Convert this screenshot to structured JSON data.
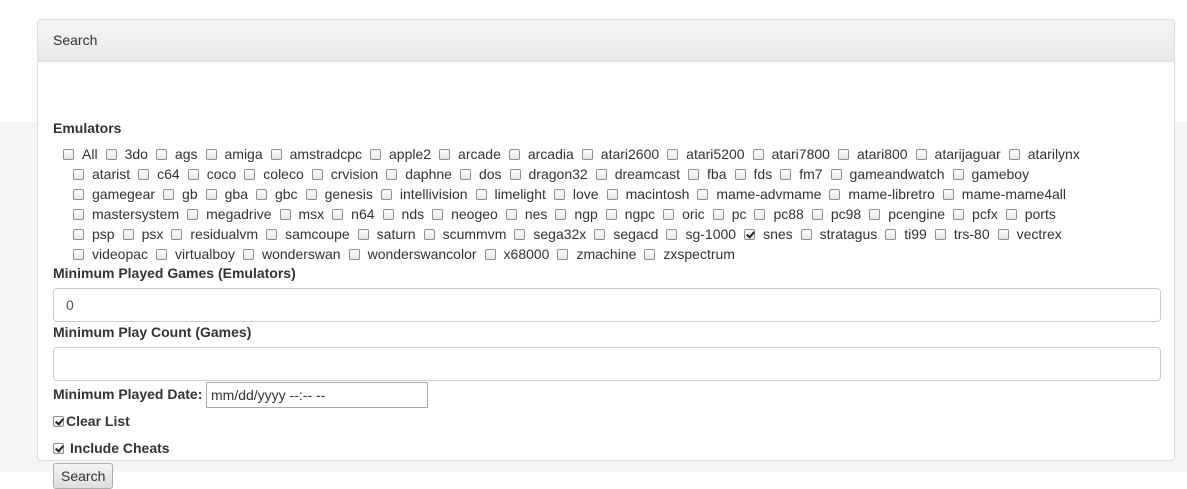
{
  "panel": {
    "title": "Search"
  },
  "emulators": {
    "label": "Emulators",
    "rows": [
      [
        {
          "name": "All",
          "checked": false
        },
        {
          "name": "3do",
          "checked": false
        },
        {
          "name": "ags",
          "checked": false
        },
        {
          "name": "amiga",
          "checked": false
        },
        {
          "name": "amstradcpc",
          "checked": false
        },
        {
          "name": "apple2",
          "checked": false
        },
        {
          "name": "arcade",
          "checked": false
        },
        {
          "name": "arcadia",
          "checked": false
        },
        {
          "name": "atari2600",
          "checked": false
        },
        {
          "name": "atari5200",
          "checked": false
        },
        {
          "name": "atari7800",
          "checked": false
        },
        {
          "name": "atari800",
          "checked": false
        },
        {
          "name": "atarijaguar",
          "checked": false
        },
        {
          "name": "atarilynx",
          "checked": false
        }
      ],
      [
        {
          "name": "atarist",
          "checked": false
        },
        {
          "name": "c64",
          "checked": false
        },
        {
          "name": "coco",
          "checked": false
        },
        {
          "name": "coleco",
          "checked": false
        },
        {
          "name": "crvision",
          "checked": false
        },
        {
          "name": "daphne",
          "checked": false
        },
        {
          "name": "dos",
          "checked": false
        },
        {
          "name": "dragon32",
          "checked": false
        },
        {
          "name": "dreamcast",
          "checked": false
        },
        {
          "name": "fba",
          "checked": false
        },
        {
          "name": "fds",
          "checked": false
        },
        {
          "name": "fm7",
          "checked": false
        },
        {
          "name": "gameandwatch",
          "checked": false
        },
        {
          "name": "gameboy",
          "checked": false
        }
      ],
      [
        {
          "name": "gamegear",
          "checked": false
        },
        {
          "name": "gb",
          "checked": false
        },
        {
          "name": "gba",
          "checked": false
        },
        {
          "name": "gbc",
          "checked": false
        },
        {
          "name": "genesis",
          "checked": false
        },
        {
          "name": "intellivision",
          "checked": false
        },
        {
          "name": "limelight",
          "checked": false
        },
        {
          "name": "love",
          "checked": false
        },
        {
          "name": "macintosh",
          "checked": false
        },
        {
          "name": "mame-advmame",
          "checked": false
        },
        {
          "name": "mame-libretro",
          "checked": false
        },
        {
          "name": "mame-mame4all",
          "checked": false
        }
      ],
      [
        {
          "name": "mastersystem",
          "checked": false
        },
        {
          "name": "megadrive",
          "checked": false
        },
        {
          "name": "msx",
          "checked": false
        },
        {
          "name": "n64",
          "checked": false
        },
        {
          "name": "nds",
          "checked": false
        },
        {
          "name": "neogeo",
          "checked": false
        },
        {
          "name": "nes",
          "checked": false
        },
        {
          "name": "ngp",
          "checked": false
        },
        {
          "name": "ngpc",
          "checked": false
        },
        {
          "name": "oric",
          "checked": false
        },
        {
          "name": "pc",
          "checked": false
        },
        {
          "name": "pc88",
          "checked": false
        },
        {
          "name": "pc98",
          "checked": false
        },
        {
          "name": "pcengine",
          "checked": false
        },
        {
          "name": "pcfx",
          "checked": false
        },
        {
          "name": "ports",
          "checked": false
        }
      ],
      [
        {
          "name": "psp",
          "checked": false
        },
        {
          "name": "psx",
          "checked": false
        },
        {
          "name": "residualvm",
          "checked": false
        },
        {
          "name": "samcoupe",
          "checked": false
        },
        {
          "name": "saturn",
          "checked": false
        },
        {
          "name": "scummvm",
          "checked": false
        },
        {
          "name": "sega32x",
          "checked": false
        },
        {
          "name": "segacd",
          "checked": false
        },
        {
          "name": "sg-1000",
          "checked": false
        },
        {
          "name": "snes",
          "checked": true
        },
        {
          "name": "stratagus",
          "checked": false
        },
        {
          "name": "ti99",
          "checked": false
        },
        {
          "name": "trs-80",
          "checked": false
        },
        {
          "name": "vectrex",
          "checked": false
        }
      ],
      [
        {
          "name": "videopac",
          "checked": false
        },
        {
          "name": "virtualboy",
          "checked": false
        },
        {
          "name": "wonderswan",
          "checked": false
        },
        {
          "name": "wonderswancolor",
          "checked": false
        },
        {
          "name": "x68000",
          "checked": false
        },
        {
          "name": "zmachine",
          "checked": false
        },
        {
          "name": "zxspectrum",
          "checked": false
        }
      ]
    ]
  },
  "min_played_games": {
    "label": "Minimum Played Games (Emulators)",
    "value": "0"
  },
  "min_play_count": {
    "label": "Minimum Play Count (Games)",
    "value": ""
  },
  "min_played_date": {
    "label": "Minimum Played Date:",
    "value": "mm/dd/yyyy  --:--  --"
  },
  "clear_list": {
    "label": "Clear List",
    "checked": true
  },
  "include_cheats": {
    "label": "Include Cheats",
    "checked": true
  },
  "search_button": {
    "label": "Search"
  }
}
